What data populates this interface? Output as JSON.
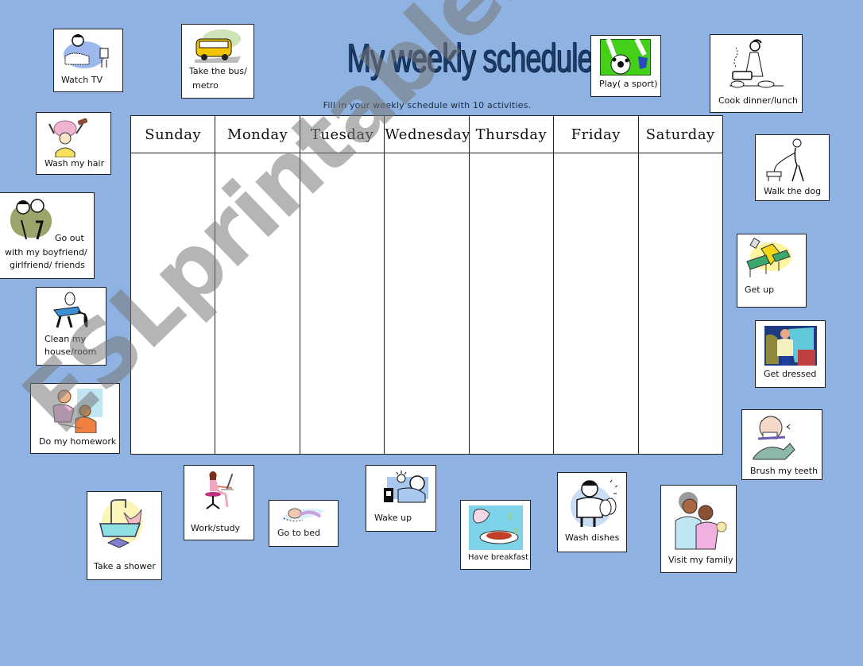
{
  "page": {
    "title": "My weekly schedule",
    "subtitle": "Fill in your weekly schedule with 10 activities.",
    "background_color": "#8EB3E2",
    "title_color": "#1F3D66"
  },
  "schedule": {
    "days": [
      "Sunday",
      "Monday",
      "Tuesday",
      "Wednesday",
      "Thursday",
      "Friday",
      "Saturday"
    ]
  },
  "activities": [
    {
      "id": "watch-tv",
      "label": "Watch TV",
      "icon": "watch-tv-icon"
    },
    {
      "id": "take-bus",
      "label_line1": "Take the bus/",
      "label_line2": "metro",
      "icon": "bus-icon"
    },
    {
      "id": "wash-hair",
      "label": "Wash my hair",
      "icon": "wash-hair-icon"
    },
    {
      "id": "go-out",
      "label_line1": "Go out",
      "label_line2": "with my boyfriend/",
      "label_line3": "girlfriend/ friends",
      "icon": "friends-icon"
    },
    {
      "id": "clean-house",
      "label_line1": "Clean my",
      "label_line2": "house/room",
      "icon": "vacuum-icon"
    },
    {
      "id": "homework",
      "label": "Do my homework",
      "icon": "homework-icon"
    },
    {
      "id": "shower",
      "label": "Take a shower",
      "icon": "bathtub-icon"
    },
    {
      "id": "work-study",
      "label": "Work/study",
      "icon": "computer-desk-icon"
    },
    {
      "id": "go-to-bed",
      "label": "Go to bed",
      "icon": "sleeping-icon"
    },
    {
      "id": "wake-up",
      "label": "Wake up",
      "icon": "alarm-clock-icon"
    },
    {
      "id": "breakfast",
      "label": "Have breakfast",
      "icon": "breakfast-icon"
    },
    {
      "id": "wash-dishes",
      "label": "Wash dishes",
      "icon": "dishes-icon"
    },
    {
      "id": "visit-family",
      "label": "Visit my family",
      "icon": "family-hug-icon"
    },
    {
      "id": "play-sport",
      "label": "Play( a sport)",
      "icon": "soccer-ball-icon"
    },
    {
      "id": "cook",
      "label": "Cook dinner/lunch",
      "icon": "cooking-icon"
    },
    {
      "id": "walk-dog",
      "label": "Walk the dog",
      "icon": "dog-walking-icon"
    },
    {
      "id": "get-up",
      "label": "Get up",
      "icon": "bed-icon"
    },
    {
      "id": "get-dressed",
      "label": "Get dressed",
      "icon": "dressing-icon"
    },
    {
      "id": "brush-teeth",
      "label": "Brush my teeth",
      "icon": "toothbrush-icon"
    }
  ],
  "watermark": "ESLprintables.com"
}
